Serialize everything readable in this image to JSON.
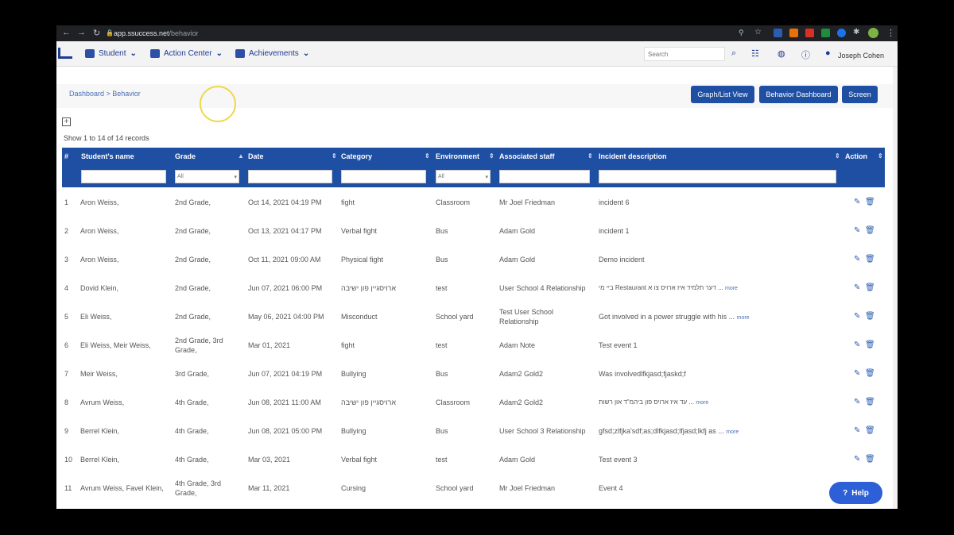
{
  "browser": {
    "url_host": "app.ssuccess.net",
    "url_path": "/behavior"
  },
  "nav": {
    "student": "Student",
    "action_center": "Action Center",
    "achievements": "Achievements",
    "search_placeholder": "Search",
    "user": "Joseph Cohen"
  },
  "breadcrumb": "Dashboard > Behavior",
  "buttons": {
    "graph_list": "Graph/List View",
    "behavior_dashboard": "Behavior Dashboard",
    "screen": "Screen"
  },
  "records": "Show 1 to 14 of 14 records",
  "columns": [
    "#",
    "Student's name",
    "Grade",
    "Date",
    "Category",
    "Environment",
    "Associated staff",
    "Incident description",
    "Action"
  ],
  "filters": {
    "grade": "All",
    "environment": "All"
  },
  "rows": [
    {
      "n": "1",
      "name": "Aron Weiss,",
      "grade": "2nd Grade,",
      "date": "Oct 14, 2021 04:19 PM",
      "category": "fight",
      "env": "Classroom",
      "staff": "Mr Joel Friedman",
      "desc": "incident 6",
      "more": ""
    },
    {
      "n": "2",
      "name": "Aron Weiss,",
      "grade": "2nd Grade,",
      "date": "Oct 13, 2021 04:17 PM",
      "category": "Verbal fight",
      "env": "Bus",
      "staff": "Adam Gold",
      "desc": "incident 1",
      "more": ""
    },
    {
      "n": "3",
      "name": "Aron Weiss,",
      "grade": "2nd Grade,",
      "date": "Oct 11, 2021 09:00 AM",
      "category": "Physical fight",
      "env": "Bus",
      "staff": "Adam Gold",
      "desc": "Demo incident",
      "more": ""
    },
    {
      "n": "4",
      "name": "Dovid Klein,",
      "grade": "2nd Grade,",
      "date": "Jun 07, 2021 06:00 PM",
      "category": "ארויסגיין פון ישיבה",
      "env": "test",
      "staff": "User School 4 Relationship",
      "desc": "בײ מי Restaurant דער תלמיד איז ארויס צו א ...",
      "more": "more"
    },
    {
      "n": "5",
      "name": "Eli Weiss,",
      "grade": "2nd Grade,",
      "date": "May 06, 2021 04:00 PM",
      "category": "Misconduct",
      "env": "School yard",
      "staff": "Test User School Relationship",
      "desc": "Got involved in a power struggle with his ...",
      "more": "more"
    },
    {
      "n": "6",
      "name": "Eli Weiss, Meir Weiss,",
      "grade": "2nd Grade, 3rd Grade,",
      "date": "Mar 01, 2021",
      "category": "fight",
      "env": "test",
      "staff": "Adam Note",
      "desc": "Test event 1",
      "more": ""
    },
    {
      "n": "7",
      "name": "Meir Weiss,",
      "grade": "3rd Grade,",
      "date": "Jun 07, 2021 04:19 PM",
      "category": "Bullying",
      "env": "Bus",
      "staff": "Adam2 Gold2",
      "desc": "Was involvedlfkjasd;fjaskd;f",
      "more": ""
    },
    {
      "n": "8",
      "name": "Avrum Weiss,",
      "grade": "4th Grade,",
      "date": "Jun 08, 2021 11:00 AM",
      "category": "ארויסגיין פון ישיבה",
      "env": "Classroom",
      "staff": "Adam2 Gold2",
      "desc": "עד איז ארויס פון ביהמ\"ד און רשות ...",
      "more": "more"
    },
    {
      "n": "9",
      "name": "Berrel Klein,",
      "grade": "4th Grade,",
      "date": "Jun 08, 2021 05:00 PM",
      "category": "Bullying",
      "env": "Bus",
      "staff": "User School 3 Relationship",
      "desc": "gfsd;zlfjka'sdf;as;dlfkjasd;lfjasd;lkfj as ...",
      "more": "more"
    },
    {
      "n": "10",
      "name": "Berrel Klein,",
      "grade": "4th Grade,",
      "date": "Mar 03, 2021",
      "category": "Verbal fight",
      "env": "test",
      "staff": "Adam Gold",
      "desc": "Test event 3",
      "more": ""
    },
    {
      "n": "11",
      "name": "Avrum Weiss, Favel Klein,",
      "grade": "4th Grade, 3rd Grade,",
      "date": "Mar 11, 2021",
      "category": "Cursing",
      "env": "School yard",
      "staff": "Mr Joel Friedman",
      "desc": "Event 4",
      "more": ""
    }
  ],
  "help": "Help"
}
